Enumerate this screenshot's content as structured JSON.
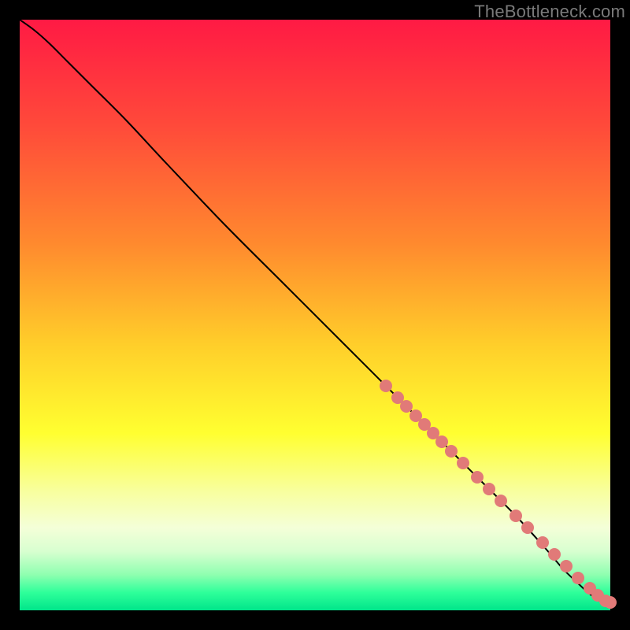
{
  "watermark": {
    "text": "TheBottleneck.com"
  },
  "gradient": {
    "stops": [
      {
        "pct": 0,
        "color": "#ff1a44"
      },
      {
        "pct": 18,
        "color": "#ff4a3a"
      },
      {
        "pct": 38,
        "color": "#ff8a2e"
      },
      {
        "pct": 55,
        "color": "#ffce2a"
      },
      {
        "pct": 70,
        "color": "#ffff30"
      },
      {
        "pct": 80,
        "color": "#f8ffa0"
      },
      {
        "pct": 86,
        "color": "#f4ffd8"
      },
      {
        "pct": 90,
        "color": "#d8ffd0"
      },
      {
        "pct": 94,
        "color": "#8effb0"
      },
      {
        "pct": 97,
        "color": "#2eff9a"
      },
      {
        "pct": 100,
        "color": "#00e58a"
      }
    ]
  },
  "chart_data": {
    "type": "line",
    "title": "",
    "xlabel": "",
    "ylabel": "",
    "xlim": [
      0,
      100
    ],
    "ylim": [
      0,
      100
    ],
    "series": [
      {
        "name": "curve",
        "x": [
          0,
          2.5,
          5,
          8,
          12,
          18,
          25,
          35,
          45,
          55,
          65,
          72,
          78,
          84,
          89,
          92,
          94.5,
          96,
          97.3,
          98.2,
          99,
          100
        ],
        "y": [
          100,
          98.2,
          96,
          93,
          89,
          83,
          75.5,
          65,
          55,
          45,
          35,
          28,
          22,
          16,
          10.5,
          7,
          4.6,
          3.2,
          2.2,
          1.6,
          1.3,
          1.3
        ]
      }
    ],
    "points": {
      "name": "markers",
      "color": "#e17a78",
      "x": [
        62,
        64,
        65.5,
        67,
        68.5,
        70,
        71.5,
        73,
        75,
        77.5,
        79.5,
        81.5,
        84,
        86,
        88.5,
        90.5,
        92.5,
        94.5,
        96.5,
        97.8,
        99.2,
        100
      ],
      "y": [
        38,
        36,
        34.5,
        33,
        31.5,
        30,
        28.5,
        27,
        25,
        22.5,
        20.5,
        18.5,
        16,
        14,
        11.5,
        9.5,
        7.5,
        5.5,
        3.8,
        2.6,
        1.6,
        1.3
      ]
    }
  }
}
